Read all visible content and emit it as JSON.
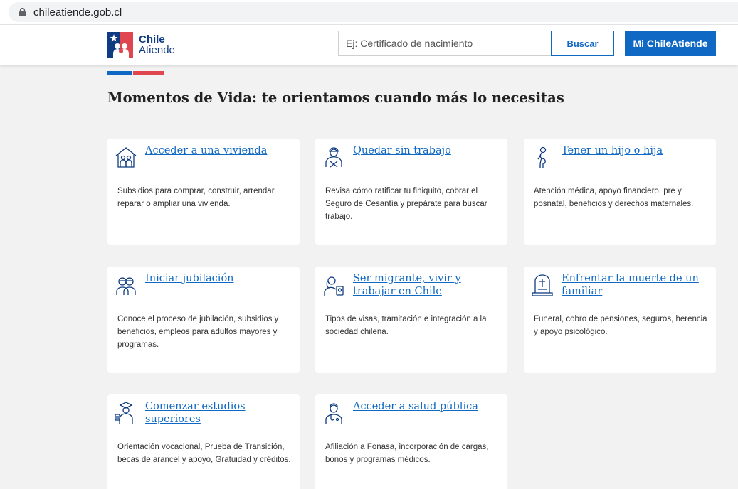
{
  "browser": {
    "url": "chileatiende.gob.cl"
  },
  "header": {
    "logo_line1": "Chile",
    "logo_line2": "Atiende",
    "search_placeholder": "Ej: Certificado de nacimiento",
    "search_button": "Buscar",
    "account_button": "Mi ChileAtiende"
  },
  "colors": {
    "brand_blue": "#0f69c4",
    "brand_red": "#e0464f",
    "dark_blue": "#0f3b82"
  },
  "section_title": "Momentos de Vida: te orientamos cuando más lo necesitas",
  "cards": [
    {
      "icon": "house-family-icon",
      "title": "Acceder a una vivienda",
      "desc": "Subsidios para comprar, construir, arrendar, reparar o ampliar una vivienda."
    },
    {
      "icon": "worker-icon",
      "title": "Quedar sin trabajo",
      "desc": "Revisa cómo ratificar tu  finiquito, cobrar el Seguro de Cesantía y prepárate para buscar trabajo."
    },
    {
      "icon": "pregnant-woman-icon",
      "title": "Tener un hijo o hija",
      "desc": "Atención médica, apoyo financiero, pre y posnatal, beneficios y derechos maternales."
    },
    {
      "icon": "elderly-couple-icon",
      "title": "Iniciar jubilación",
      "desc": "Conoce el proceso de jubilación, subsidios y beneficios, empleos para adultos mayores y programas."
    },
    {
      "icon": "migrant-passport-icon",
      "title": "Ser migrante, vivir y trabajar en Chile",
      "desc": "Tipos de visas, tramitación e integración a la sociedad chilena."
    },
    {
      "icon": "tombstone-icon",
      "title": "Enfrentar la muerte de un familiar",
      "desc": "Funeral, cobro de pensiones, seguros, herencia y apoyo psicológico."
    },
    {
      "icon": "student-icon",
      "title": "Comenzar estudios superiores",
      "desc": "Orientación vocacional, Prueba de Transición, becas de arancel y apoyo, Gratuidad y créditos."
    },
    {
      "icon": "doctor-icon",
      "title": "Acceder a salud pública",
      "desc": "Afiliación a Fonasa, incorporación de cargas, bonos y programas médicos."
    }
  ]
}
